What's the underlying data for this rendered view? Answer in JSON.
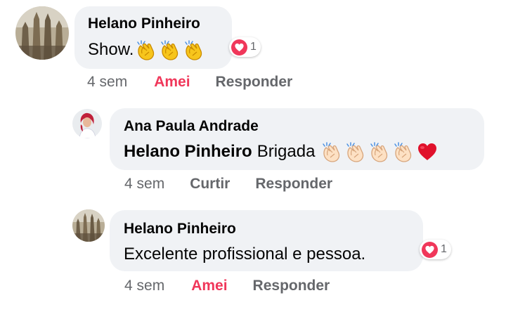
{
  "comments": [
    {
      "author": "Helano Pinheiro",
      "text": "Show.",
      "emojis": [
        "clapping-hands",
        "clapping-hands",
        "clapping-hands"
      ],
      "reaction_count": "1",
      "actions": {
        "time": "4 sem",
        "like": "Amei",
        "reply": "Responder"
      }
    },
    {
      "author": "Ana Paula Andrade",
      "mention": "Helano Pinheiro",
      "text": "Brigada",
      "emojis": [
        "clapping-hands-light",
        "clapping-hands-light",
        "clapping-hands-light",
        "clapping-hands-light",
        "red-heart"
      ],
      "actions": {
        "time": "4 sem",
        "like": "Curtir",
        "reply": "Responder"
      }
    },
    {
      "author": "Helano Pinheiro",
      "text": "Excelente profissional e pessoa.",
      "reaction_count": "1",
      "actions": {
        "time": "4 sem",
        "like": "Amei",
        "reply": "Responder"
      }
    }
  ],
  "colors": {
    "bubble": "#f0f2f5",
    "love": "#f0375a",
    "meta": "#65676b",
    "text": "#050505"
  }
}
